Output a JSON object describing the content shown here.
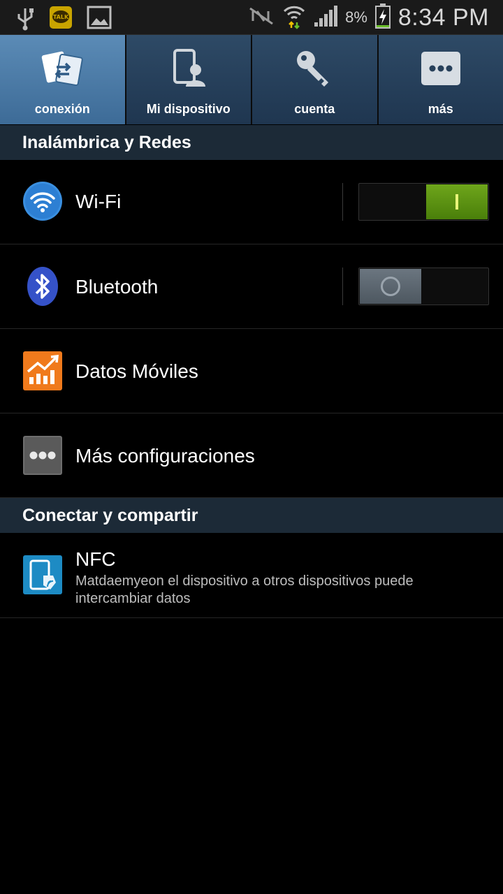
{
  "status_bar": {
    "left_icons": [
      "usb-icon",
      "kakaotalk-icon",
      "image-icon"
    ],
    "right_icons": [
      "nfc-off-icon",
      "wifi-icon",
      "signal-icon",
      "battery-charging-icon"
    ],
    "battery_percent": "8%",
    "time": "8:34 PM",
    "talk_badge": "TALK"
  },
  "tabs": [
    {
      "label": "conexión",
      "icon": "connections-icon",
      "active": true
    },
    {
      "label": "Mi dispositivo",
      "icon": "my-device-icon",
      "active": false
    },
    {
      "label": "cuenta",
      "icon": "key-icon",
      "active": false
    },
    {
      "label": "más",
      "icon": "more-icon",
      "active": false
    }
  ],
  "sections": {
    "wireless": {
      "title": "Inalámbrica y Redes"
    },
    "connect": {
      "title": "Conectar y compartir"
    }
  },
  "items": {
    "wifi": {
      "label": "Wi-Fi",
      "icon": "wifi-icon",
      "switch": "on"
    },
    "bluetooth": {
      "label": "Bluetooth",
      "icon": "bluetooth-icon",
      "switch": "off"
    },
    "mobile_data": {
      "label": "Datos Móviles",
      "icon": "data-usage-icon"
    },
    "more_settings": {
      "label": "Más configuraciones",
      "icon": "more-dots-icon"
    },
    "nfc": {
      "label": "NFC",
      "subtitle": "Matdaemyeon el dispositivo a otros dispositivos puede intercambiar datos",
      "icon": "nfc-icon"
    }
  },
  "colors": {
    "tab_active": "#4a78a3",
    "tab_inactive": "#27405a",
    "section_header": "#1c2a37",
    "switch_on": "#5a9012",
    "switch_off": "#5d6770"
  }
}
